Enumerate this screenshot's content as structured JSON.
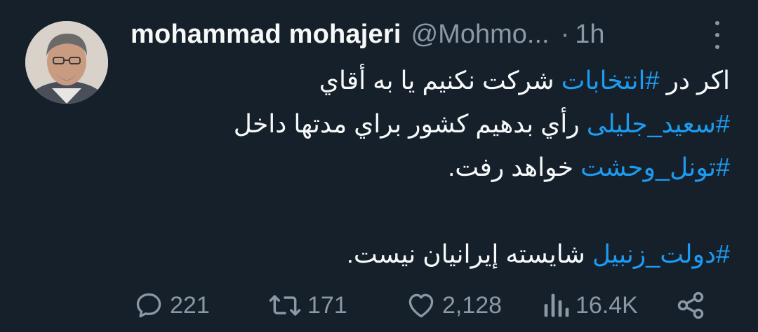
{
  "author": {
    "display_name": "mohammad mohajeri",
    "handle": "@Mohmo...",
    "separator": "·",
    "time": "1h"
  },
  "icons": {
    "avatar": "profile-photo",
    "more": "more-vertical-icon",
    "reply": "comment-bubble-icon",
    "retweet": "retweet-arrows-icon",
    "like": "heart-icon",
    "views": "bar-chart-icon",
    "share": "share-nodes-icon"
  },
  "tweet": {
    "line1": {
      "text1": "اکر در ",
      "hashtag": "#انتخابات",
      "text2": " شركت نكنيم يا به أقاي"
    },
    "line2": {
      "hashtag": "#سعيد_جليلى",
      "text": " رأي بدهيم كشور براي مدتها داخل"
    },
    "line3": {
      "hashtag": "#تونل_وحشت",
      "text": " خواهد رفت."
    },
    "line5": {
      "hashtag": "#دولت_زنبيل",
      "text": " شايسته إيرانيان نيست."
    }
  },
  "stats": {
    "replies": "221",
    "retweets": "171",
    "likes": "2,128",
    "views": "16.4K"
  },
  "colors": {
    "background": "#15202b",
    "text": "#f7f9f9",
    "secondary": "#8b98a5",
    "accent": "#1d9bf0"
  }
}
